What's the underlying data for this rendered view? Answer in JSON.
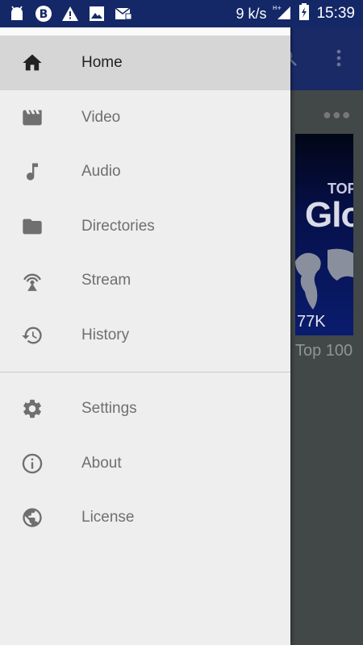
{
  "status_bar": {
    "net_speed": "9 k/s",
    "time": "15:39",
    "left_icons": [
      "android-icon",
      "b-circle-icon",
      "warning-icon",
      "image-icon",
      "mail-icon"
    ]
  },
  "background": {
    "thumb_title_top": "TOP",
    "thumb_title_big": "Glo",
    "thumb_views": "77K",
    "thumb_caption": "Top 100"
  },
  "drawer": {
    "primary_items": [
      {
        "label": "Home",
        "icon": "home-icon",
        "active": true
      },
      {
        "label": "Video",
        "icon": "movie-icon"
      },
      {
        "label": "Audio",
        "icon": "music-note-icon"
      },
      {
        "label": "Directories",
        "icon": "folder-icon"
      },
      {
        "label": "Stream",
        "icon": "antenna-icon"
      },
      {
        "label": "History",
        "icon": "history-icon"
      }
    ],
    "secondary_items": [
      {
        "label": "Settings",
        "icon": "gear-icon"
      },
      {
        "label": "About",
        "icon": "info-icon"
      },
      {
        "label": "License",
        "icon": "globe-icon"
      }
    ]
  },
  "colors": {
    "status_bar": "#142868",
    "drawer_bg": "#eeeeee",
    "active_item_bg": "#d6d6d6",
    "icon_gray": "#6f6f6f"
  }
}
